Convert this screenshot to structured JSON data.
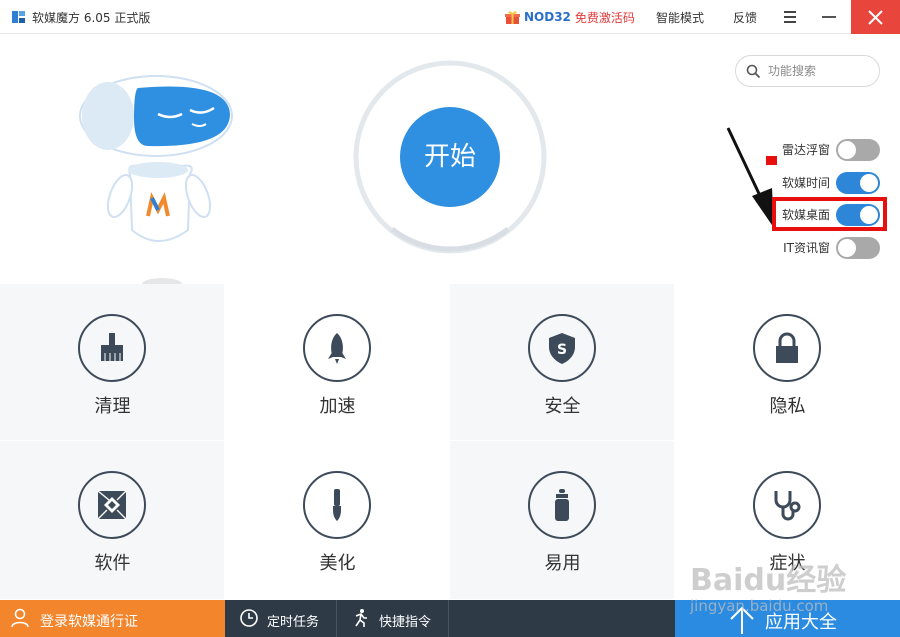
{
  "titlebar": {
    "app_title": "软媒魔方 6.05 正式版",
    "promo_brand": "NOD32",
    "promo_text": "免费激活码",
    "mode_label": "智能模式",
    "feedback_label": "反馈"
  },
  "main": {
    "start_label": "开始",
    "search_placeholder": "功能搜索",
    "toggles": [
      {
        "label": "雷达浮窗",
        "on": false
      },
      {
        "label": "软媒时间",
        "on": true
      },
      {
        "label": "软媒桌面",
        "on": true
      },
      {
        "label": "IT资讯窗",
        "on": false
      }
    ]
  },
  "tiles": [
    {
      "label": "清理",
      "icon": "broom-icon"
    },
    {
      "label": "加速",
      "icon": "rocket-icon"
    },
    {
      "label": "安全",
      "icon": "shield-icon"
    },
    {
      "label": "隐私",
      "icon": "lock-icon"
    },
    {
      "label": "软件",
      "icon": "aperture-icon"
    },
    {
      "label": "美化",
      "icon": "paintbrush-icon"
    },
    {
      "label": "易用",
      "icon": "bottle-icon"
    },
    {
      "label": "症状",
      "icon": "stethoscope-icon"
    }
  ],
  "bottom": {
    "login_label": "登录软媒通行证",
    "task_label": "定时任务",
    "cmd_label": "快捷指令",
    "apps_label": "应用大全"
  },
  "watermark": {
    "line1": "Baidu经验",
    "line2": "jingyan.baidu.com"
  },
  "colors": {
    "accent_blue": "#2f8fe0",
    "orange": "#f3852c",
    "dark": "#2f3a47",
    "annotation_red": "#e8100e"
  }
}
